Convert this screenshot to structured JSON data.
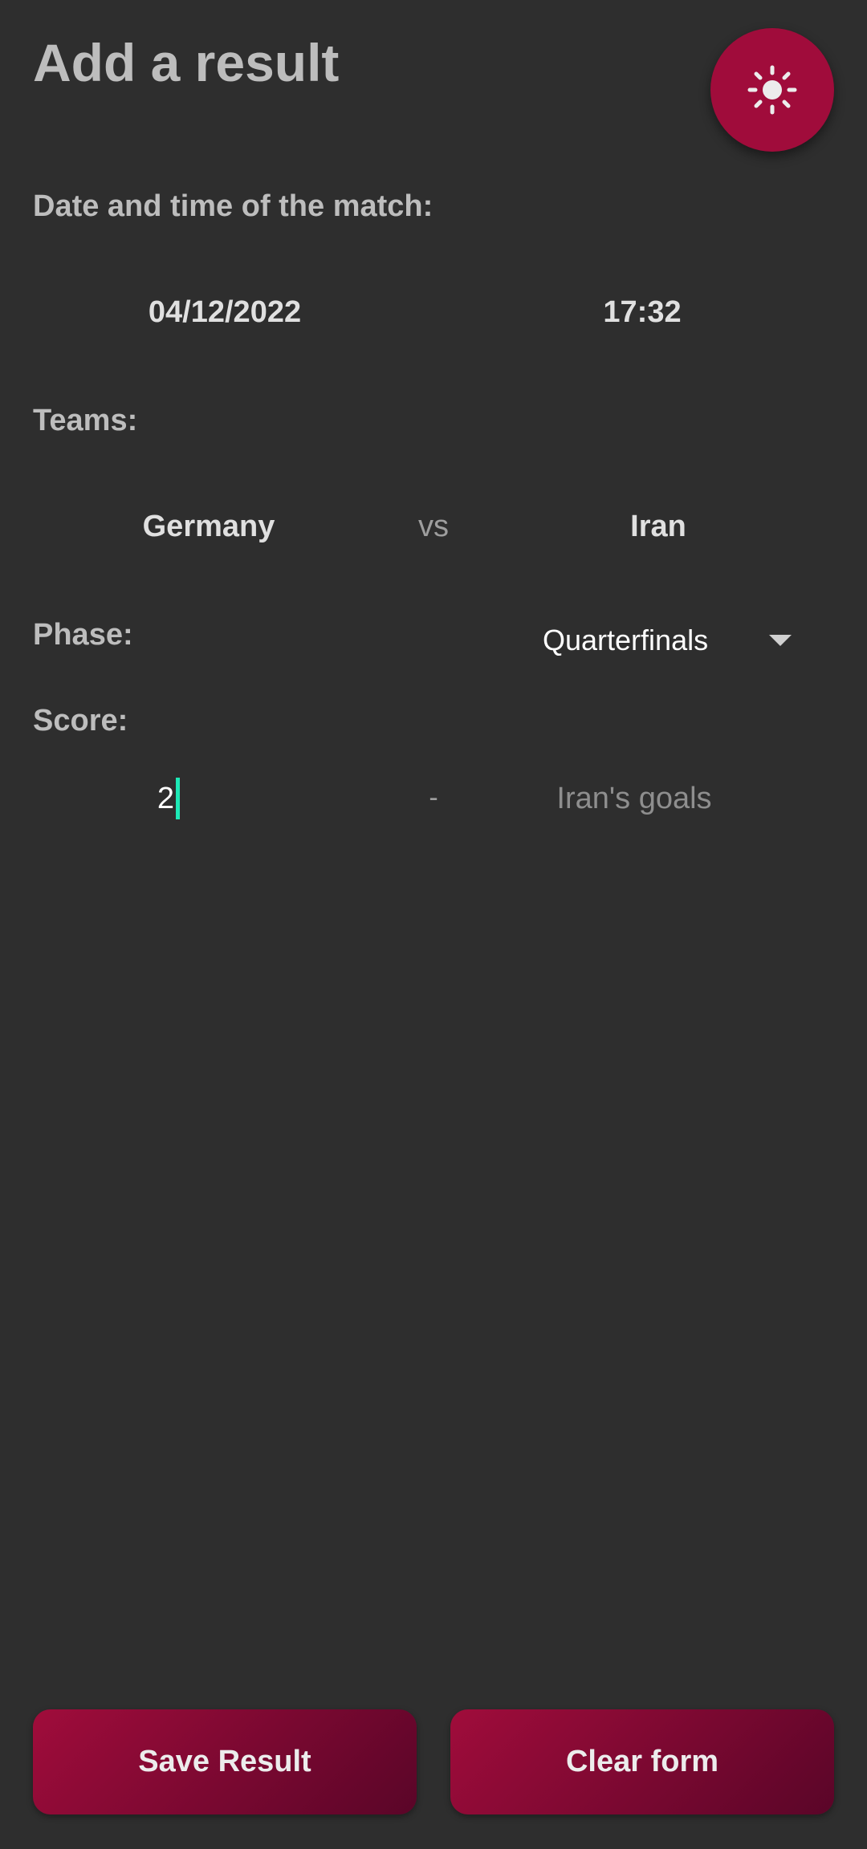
{
  "header": {
    "title": "Add a result",
    "theme_icon": "sun-icon"
  },
  "date_time": {
    "label": "Date and time of the match:",
    "date": "04/12/2022",
    "time": "17:32"
  },
  "teams": {
    "label": "Teams:",
    "home": "Germany",
    "separator": "vs",
    "away": "Iran"
  },
  "phase": {
    "label": "Phase:",
    "selected": "Quarterfinals",
    "icon": "dropdown-arrow-icon"
  },
  "score": {
    "label": "Score:",
    "home_value": "2",
    "separator": "-",
    "away_placeholder": "Iran's goals"
  },
  "actions": {
    "save_label": "Save Result",
    "clear_label": "Clear form"
  },
  "colors": {
    "background": "#2e2e2e",
    "accent": "#a00c3b",
    "accent_dark": "#5a0528",
    "caret": "#1de9b6"
  }
}
